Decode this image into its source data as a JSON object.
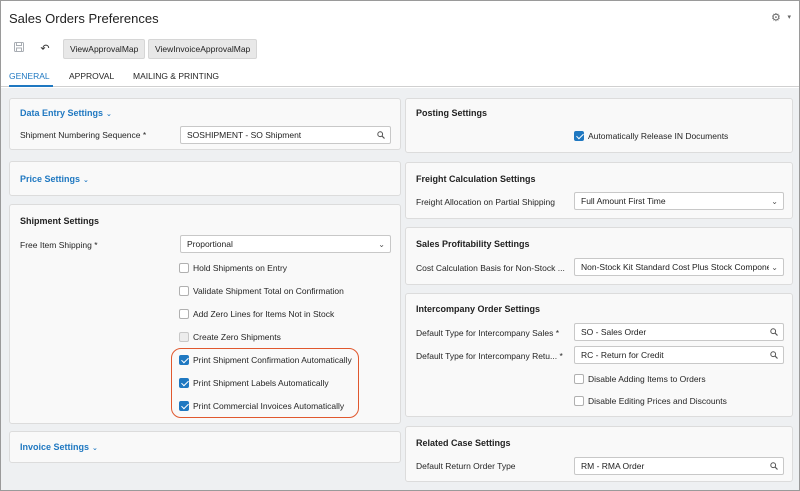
{
  "app": {
    "title": "Sales Orders Preferences"
  },
  "toolbar": {
    "save_icon": "save-icon",
    "undo_icon": "undo-icon",
    "view_approval_map": "ViewApprovalMap",
    "view_invoice_approval_map": "ViewInvoiceApprovalMap"
  },
  "tabs": [
    {
      "label": "GENERAL",
      "active": true
    },
    {
      "label": "APPROVAL",
      "active": false
    },
    {
      "label": "MAILING & PRINTING",
      "active": false
    }
  ],
  "data_entry": {
    "title": "Data Entry Settings",
    "shipment_numbering_label": "Shipment Numbering Sequence",
    "required_mark": "*",
    "shipment_numbering_value": "SOSHIPMENT - SO Shipment"
  },
  "price": {
    "title": "Price Settings"
  },
  "shipment": {
    "title": "Shipment Settings",
    "free_item_label": "Free Item Shipping",
    "free_item_value": "Proportional",
    "checkboxes": [
      {
        "label": "Hold Shipments on Entry",
        "checked": false
      },
      {
        "label": "Validate Shipment Total on Confirmation",
        "checked": false
      },
      {
        "label": "Add Zero Lines for Items Not in Stock",
        "checked": false
      },
      {
        "label": "Create Zero Shipments",
        "checked": false
      },
      {
        "label": "Print Shipment Confirmation Automatically",
        "checked": true
      },
      {
        "label": "Print Shipment Labels Automatically",
        "checked": true
      },
      {
        "label": "Print Commercial Invoices Automatically",
        "checked": true
      }
    ]
  },
  "invoice": {
    "title": "Invoice Settings"
  },
  "posting": {
    "title": "Posting Settings",
    "auto_release_label": "Automatically Release IN Documents",
    "auto_release_checked": true
  },
  "freight": {
    "title": "Freight Calculation Settings",
    "allocation_label": "Freight Allocation on Partial Shipping",
    "allocation_value": "Full Amount First Time"
  },
  "profitability": {
    "title": "Sales Profitability Settings",
    "cost_basis_label": "Cost Calculation Basis for Non-Stock ...",
    "cost_basis_value": "Non-Stock Kit Standard Cost Plus Stock Componer"
  },
  "intercompany": {
    "title": "Intercompany Order Settings",
    "sales_type_label": "Default Type for Intercompany Sales",
    "sales_type_value": "SO - Sales Order",
    "return_type_label": "Default Type for Intercompany Retu...",
    "return_type_value": "RC - Return for Credit",
    "disable_adding_label": "Disable Adding Items to Orders",
    "disable_editing_label": "Disable Editing Prices and Discounts"
  },
  "related_case": {
    "title": "Related Case Settings",
    "return_order_label": "Default Return Order Type",
    "return_order_value": "RM - RMA Order"
  },
  "colors": {
    "accent": "#1f78c1",
    "highlight": "#e0582e"
  }
}
